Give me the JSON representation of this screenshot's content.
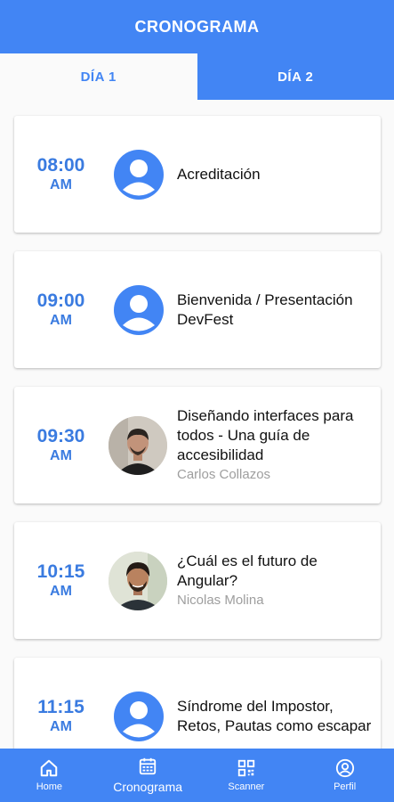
{
  "app_bar": {
    "title": "CRONOGRAMA"
  },
  "tabs": [
    {
      "label": "DÍA 1",
      "active": true
    },
    {
      "label": "DÍA 2",
      "active": false
    }
  ],
  "sessions": [
    {
      "time": "08:00",
      "period": "AM",
      "title": "Acreditación",
      "speaker": "",
      "avatar": "default-avatar-icon"
    },
    {
      "time": "09:00",
      "period": "AM",
      "title": "Bienvenida / Presentación DevFest",
      "speaker": "",
      "avatar": "default-avatar-icon"
    },
    {
      "time": "09:30",
      "period": "AM",
      "title": "Diseñando interfaces para todos - Una guía de accesibilidad",
      "speaker": "Carlos Collazos",
      "avatar": "speaker-photo"
    },
    {
      "time": "10:15",
      "period": "AM",
      "title": "¿Cuál es el futuro de Angular?",
      "speaker": "Nicolas Molina",
      "avatar": "speaker-photo"
    },
    {
      "time": "11:15",
      "period": "AM",
      "title": "Síndrome del Impostor, Retos, Pautas como escapar",
      "speaker": "",
      "avatar": "default-avatar-icon"
    }
  ],
  "bottom_nav": [
    {
      "label": "Home",
      "icon": "home-icon"
    },
    {
      "label": "Cronograma",
      "icon": "calendar-icon",
      "active": true
    },
    {
      "label": "Scanner",
      "icon": "qr-code-icon"
    },
    {
      "label": "Perfil",
      "icon": "account-circle-icon"
    }
  ],
  "colors": {
    "primary": "#4285f4",
    "time_text": "#3a7be0",
    "speaker_text": "#9e9e9e"
  }
}
